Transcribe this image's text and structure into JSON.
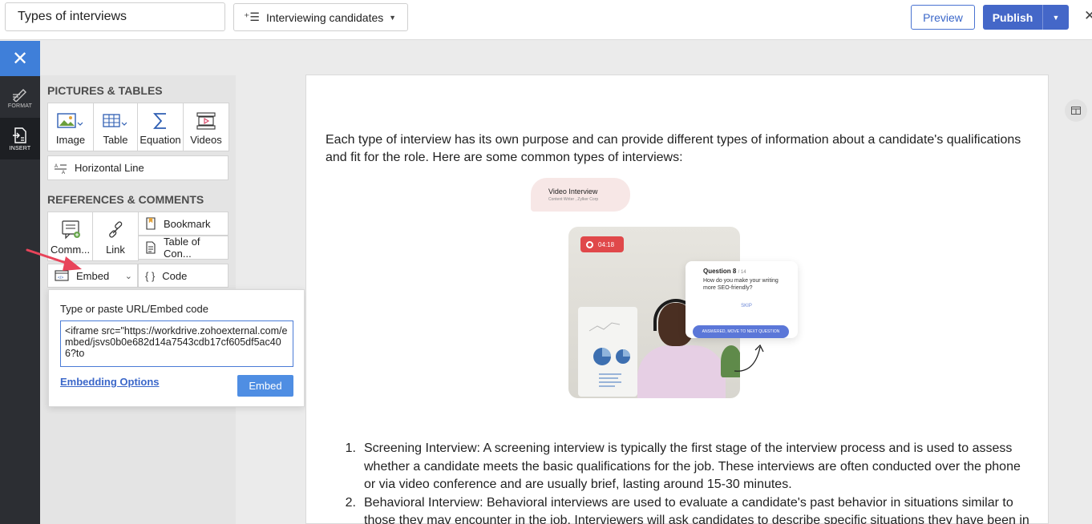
{
  "topbar": {
    "title_value": "Types of interviews",
    "category_label": "Interviewing candidates",
    "preview_label": "Preview",
    "publish_label": "Publish",
    "close_symbol": "✕"
  },
  "rail": {
    "items": [
      {
        "label": "FORMAT",
        "icon": "format-icon"
      },
      {
        "label": "INSERT",
        "icon": "insert-icon"
      }
    ]
  },
  "panel": {
    "pictures_title": "PICTURES & TABLES",
    "pictures_tiles": [
      {
        "label": "Image",
        "icon": "image-icon"
      },
      {
        "label": "Table",
        "icon": "table-icon"
      },
      {
        "label": "Equation",
        "icon": "sigma-icon"
      },
      {
        "label": "Videos",
        "icon": "video-icon"
      }
    ],
    "horizontal_line_label": "Horizontal Line",
    "references_title": "REFERENCES & COMMENTS",
    "comment_label": "Comm...",
    "link_label": "Link",
    "bookmark_label": "Bookmark",
    "toc_label": "Table of Con...",
    "embed_label": "Embed",
    "code_label": "Code"
  },
  "embed_popup": {
    "label": "Type or paste URL/Embed code",
    "code_value": "<iframe src=\"https://workdrive.zohoexternal.com/embed/jsvs0b0e682d14a7543cdb17cf605df5ac406?to",
    "options_link": "Embedding Options",
    "embed_button": "Embed"
  },
  "document": {
    "intro": "Each type of interview has its own purpose and can provide different types of information about a candidate's qualifications and fit for the role. Here are some common types of interviews:",
    "list": [
      {
        "num": "1.",
        "text": "Screening Interview: A screening interview is typically the first stage of the interview process and is used to assess whether a candidate meets the basic qualifications for the job. These interviews are often conducted over the phone or via video conference and are usually brief, lasting around 15-30 minutes."
      },
      {
        "num": "2.",
        "text": "Behavioral Interview: Behavioral interviews are used to evaluate a candidate's past behavior in situations similar to those they may encounter in the job. Interviewers will ask candidates to describe specific situations they have been in and how"
      }
    ]
  },
  "illustration": {
    "pill_title": "Video Interview",
    "pill_sub": "Content Writer , Zylker Corp",
    "rec_time": "04:18",
    "question_title": "Question 8",
    "question_count": "/ 14",
    "question_text": "How do you make your writing more SEO-friendly?",
    "skip": "SKIP",
    "next_button": "ANSWERED, MOVE TO NEXT QUESTION"
  },
  "colors": {
    "accent": "#4467c8",
    "rail_active": "#3f7fd9",
    "annotation_arrow": "#e8445a"
  }
}
